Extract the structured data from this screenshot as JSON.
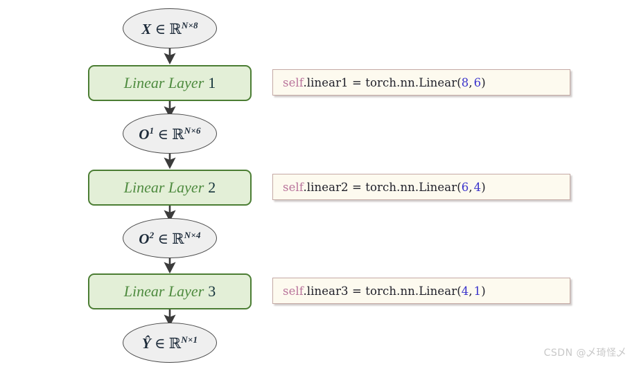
{
  "diagram": {
    "title": "Linear layer stack with PyTorch code",
    "background_color": "#ffffff",
    "nodes": [
      {
        "id": "input-tensor",
        "kind": "ellipse",
        "symbol": "X",
        "superscript": "",
        "relation": "∈",
        "space": "ℝ",
        "dims": "N×8",
        "text": "X ∈ ℝ^{N×8}",
        "fill": "#efefef",
        "stroke": "#4a4a4a"
      },
      {
        "id": "linear-layer-1",
        "kind": "box",
        "name": "Linear Layer",
        "number": "1",
        "text": "Linear Layer 1",
        "fill": "#e3efd7",
        "stroke": "#4b7d33"
      },
      {
        "id": "output-1-tensor",
        "kind": "ellipse",
        "symbol": "O",
        "superscript": "1",
        "relation": "∈",
        "space": "ℝ",
        "dims": "N×6",
        "text": "O¹ ∈ ℝ^{N×6}",
        "fill": "#efefef",
        "stroke": "#4a4a4a"
      },
      {
        "id": "linear-layer-2",
        "kind": "box",
        "name": "Linear Layer",
        "number": "2",
        "text": "Linear Layer 2",
        "fill": "#e3efd7",
        "stroke": "#4b7d33"
      },
      {
        "id": "output-2-tensor",
        "kind": "ellipse",
        "symbol": "O",
        "superscript": "2",
        "relation": "∈",
        "space": "ℝ",
        "dims": "N×4",
        "text": "O² ∈ ℝ^{N×4}",
        "fill": "#efefef",
        "stroke": "#4a4a4a"
      },
      {
        "id": "linear-layer-3",
        "kind": "box",
        "name": "Linear Layer",
        "number": "3",
        "text": "Linear Layer 3",
        "fill": "#e3efd7",
        "stroke": "#4b7d33"
      },
      {
        "id": "prediction-tensor",
        "kind": "ellipse",
        "symbol": "Ŷ",
        "superscript": "",
        "relation": "∈",
        "space": "ℝ",
        "dims": "N×1",
        "text": "Ŷ ∈ ℝ^{N×1}",
        "fill": "#efefef",
        "stroke": "#4a4a4a"
      }
    ],
    "code_boxes": [
      {
        "id": "code-linear1",
        "self_kw": "self",
        "attribute": ".linear1",
        "assign": " = ",
        "call": "torch.nn.Linear",
        "open_paren": "(",
        "arg_in": "8",
        "arg_sep": ",",
        "arg_out": "6",
        "close_paren": ")",
        "full_text": "self.linear1 = torch.nn.Linear(8, 6)",
        "fill": "#fdfaef",
        "stroke": "#c4a9a4"
      },
      {
        "id": "code-linear2",
        "self_kw": "self",
        "attribute": ".linear2",
        "assign": " = ",
        "call": "torch.nn.Linear",
        "open_paren": "(",
        "arg_in": "6",
        "arg_sep": ",",
        "arg_out": "4",
        "close_paren": ")",
        "full_text": "self.linear2 = torch.nn.Linear(6, 4)",
        "fill": "#fdfaef",
        "stroke": "#c4a9a4"
      },
      {
        "id": "code-linear3",
        "self_kw": "self",
        "attribute": ".linear3",
        "assign": " = ",
        "call": "torch.nn.Linear",
        "open_paren": "(",
        "arg_in": "4",
        "arg_sep": ",",
        "arg_out": "1",
        "close_paren": ")",
        "full_text": "self.linear3 = torch.nn.Linear(4, 1)",
        "fill": "#fdfaef",
        "stroke": "#c4a9a4"
      }
    ],
    "arrows": {
      "count": 6,
      "color": "#3b3b3b",
      "direction": "downward"
    },
    "colors": {
      "layer_text": "#4e8b3f",
      "layer_number": "#14333a",
      "code_self": "#b9739b",
      "code_number": "#3a33cc",
      "code_default": "#20202a",
      "ellipse_text": "#1d2b3a"
    }
  },
  "watermark": {
    "text": "CSDN @乄琦怪乄"
  }
}
